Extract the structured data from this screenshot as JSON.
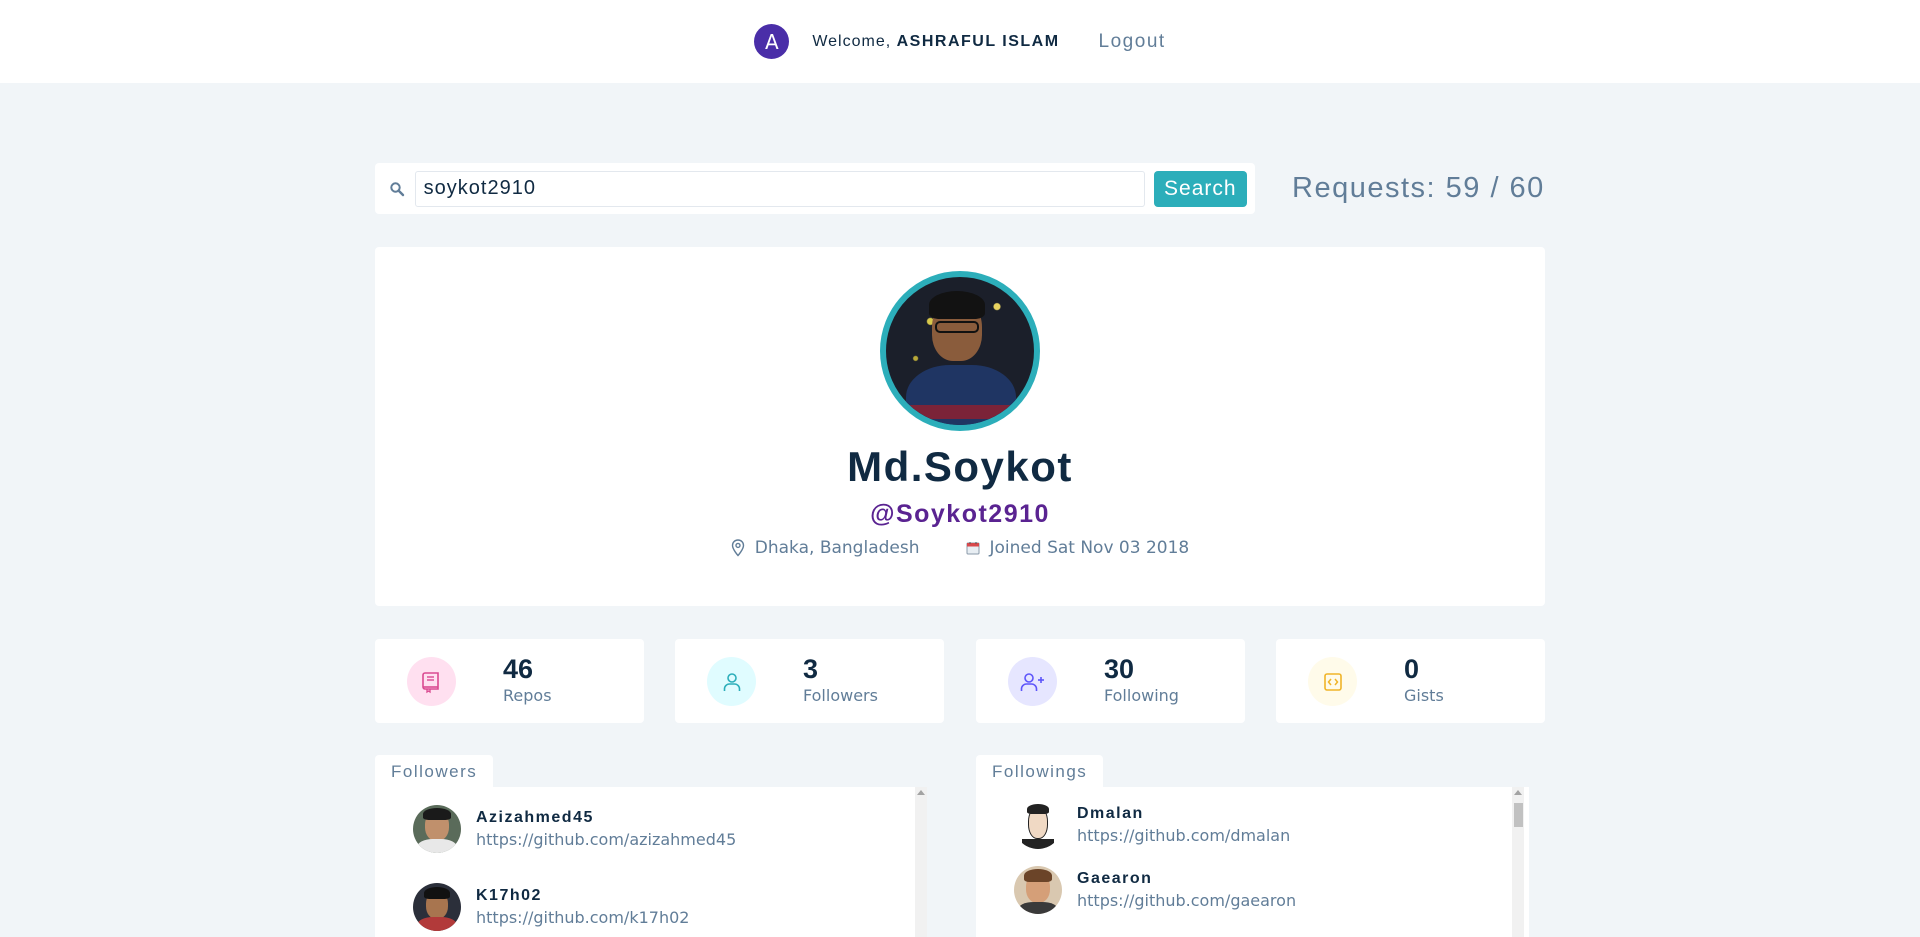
{
  "nav": {
    "avatar_initial": "A",
    "welcome_prefix": "Welcome,",
    "user_name": "ASHRAFUL ISLAM",
    "logout_label": "Logout"
  },
  "search": {
    "value": "soykot2910",
    "button_label": "Search",
    "requests_text": "Requests: 59 / 60"
  },
  "profile": {
    "name": "Md.Soykot",
    "login": "@Soykot2910",
    "location": "Dhaka, Bangladesh",
    "joined": "Joined Sat Nov 03 2018"
  },
  "stats": [
    {
      "value": "46",
      "label": "Repos",
      "icon": "book-icon",
      "color": "#da4a91",
      "bg": "#ffe0f0"
    },
    {
      "value": "3",
      "label": "Followers",
      "icon": "user-icon",
      "color": "#2caeba",
      "bg": "#e0fcff"
    },
    {
      "value": "30",
      "label": "Following",
      "icon": "user-plus-icon",
      "color": "#5d55fa",
      "bg": "#e6e6ff"
    },
    {
      "value": "0",
      "label": "Gists",
      "icon": "code-icon",
      "color": "#f0b429",
      "bg": "#fffbea"
    }
  ],
  "followers": {
    "title": "Followers",
    "items": [
      {
        "name": "Azizahmed45",
        "url": "https://github.com/azizahmed45"
      },
      {
        "name": "K17h02",
        "url": "https://github.com/k17h02"
      }
    ]
  },
  "followings": {
    "title": "Followings",
    "items": [
      {
        "name": "Dmalan",
        "url": "https://github.com/dmalan"
      },
      {
        "name": "Gaearon",
        "url": "https://github.com/gaearon"
      }
    ]
  },
  "colors": {
    "accent": "#2caeba",
    "login": "#5a2391",
    "avatar_bg": "#4a2ea8",
    "background": "#f1f5f8"
  }
}
